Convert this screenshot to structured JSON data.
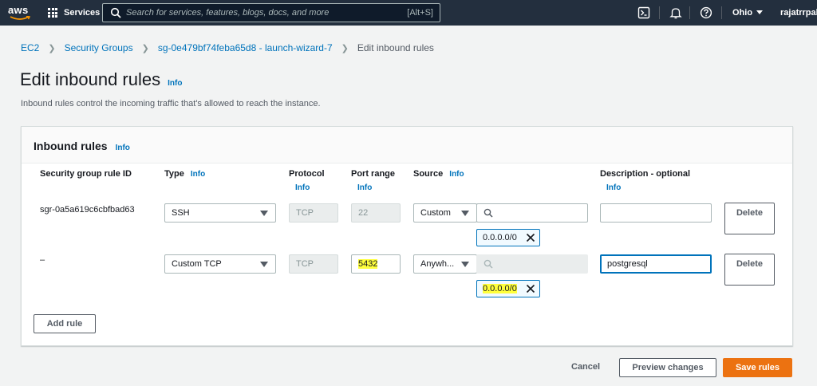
{
  "nav": {
    "logo_text": "aws",
    "services_label": "Services",
    "search_placeholder": "Search for services, features, blogs, docs, and more",
    "search_shortcut": "[Alt+S]",
    "region": "Ohio",
    "user": "rajatrrpala"
  },
  "breadcrumb": {
    "items": [
      "EC2",
      "Security Groups",
      "sg-0e479bf74feba65d8 - launch-wizard-7"
    ],
    "current": "Edit inbound rules"
  },
  "page": {
    "title": "Edit inbound rules",
    "info": "Info",
    "description": "Inbound rules control the incoming traffic that's allowed to reach the instance."
  },
  "panel": {
    "title": "Inbound rules",
    "info": "Info",
    "columns": {
      "rule_id": "Security group rule ID",
      "type": "Type",
      "protocol": "Protocol",
      "port_range": "Port range",
      "source": "Source",
      "description": "Description - optional",
      "info": "Info"
    },
    "rows": [
      {
        "rule_id": "sgr-0a5a619c6cbfbad63",
        "type": "SSH",
        "protocol": "TCP",
        "port_range": "22",
        "source_type": "Custom",
        "source_search": "",
        "cidr": "0.0.0.0/0",
        "description": "",
        "delete_label": "Delete"
      },
      {
        "rule_id": "–",
        "type": "Custom TCP",
        "protocol": "TCP",
        "port_range": "5432",
        "source_type": "Anywh...",
        "source_search": "",
        "cidr": "0.0.0.0/0",
        "description": "postgresql",
        "delete_label": "Delete"
      }
    ],
    "add_rule_label": "Add rule"
  },
  "footer": {
    "cancel": "Cancel",
    "preview": "Preview changes",
    "save": "Save rules"
  },
  "colors": {
    "nav_bg": "#232f3e",
    "link": "#0073bb",
    "primary": "#ec7211",
    "highlight": "#ffff3c"
  }
}
